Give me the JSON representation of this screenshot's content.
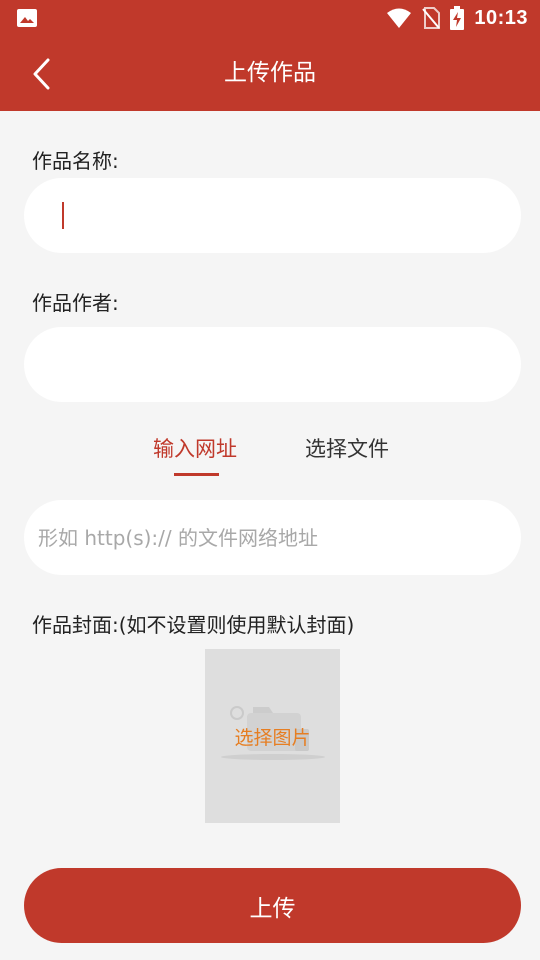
{
  "status_bar": {
    "time": "10:13",
    "icons": [
      "gallery-icon",
      "wifi-icon",
      "no-sim-icon",
      "battery-charging-icon"
    ]
  },
  "app_bar": {
    "title": "上传作品",
    "back_icon": "chevron-left-icon"
  },
  "form": {
    "name_label": "作品名称:",
    "name_value": "",
    "author_label": "作品作者:",
    "author_value": "",
    "tabs": [
      {
        "label": "输入网址",
        "active": true
      },
      {
        "label": "选择文件",
        "active": false
      }
    ],
    "url_placeholder": "形如 http(s):// 的文件网络地址",
    "url_value": "",
    "cover_label": "作品封面:(如不设置则使用默认封面)",
    "cover_button_label": "选择图片",
    "upload_button_label": "上传"
  },
  "colors": {
    "primary": "#c0392b",
    "background": "#f5f5f5",
    "cover_text": "#e67e22"
  }
}
